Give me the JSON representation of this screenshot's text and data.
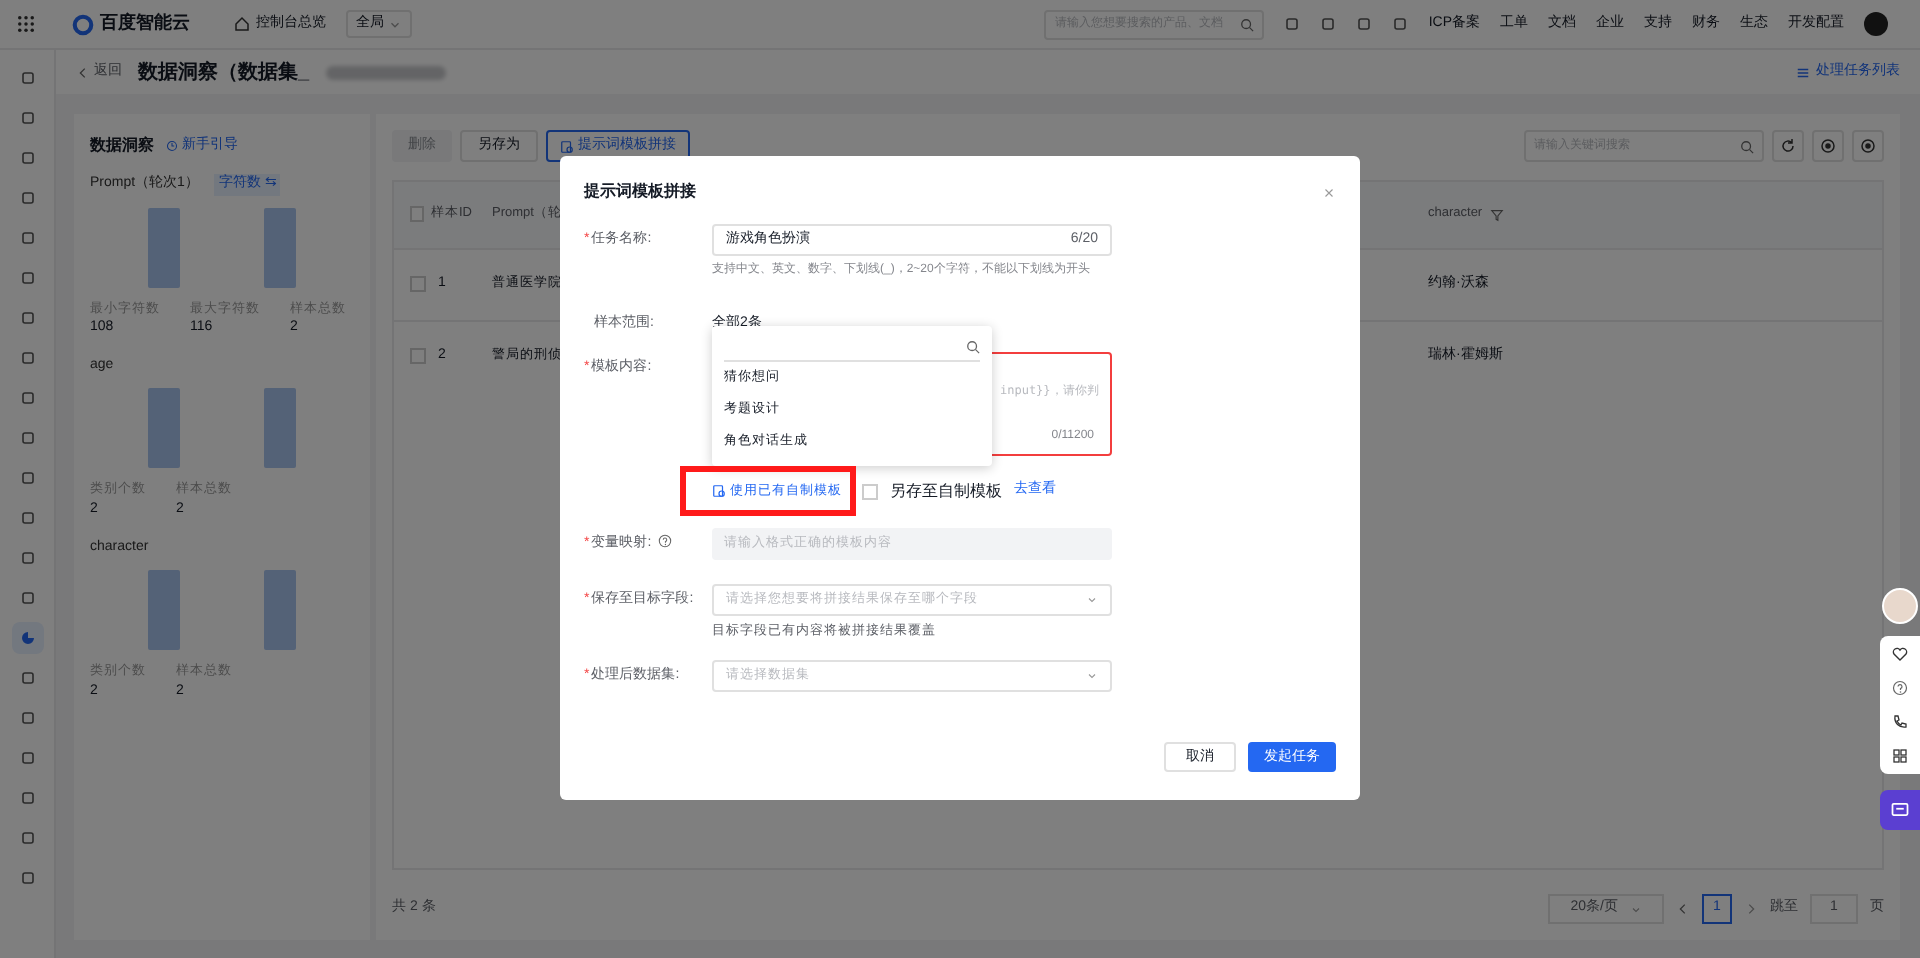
{
  "topbar": {
    "logo": "百度智能云",
    "console": "控制台总览",
    "region": "全局",
    "search_placeholder": "请输入您想要搜索的产品、文档",
    "links": [
      "ICP备案",
      "工单",
      "文档",
      "企业",
      "支持",
      "财务",
      "生态",
      "开发配置"
    ]
  },
  "header": {
    "back": "返回",
    "title": "数据洞察（数据集_",
    "task_list": "处理任务列表"
  },
  "rail": [
    {
      "selected": false
    },
    {
      "selected": false
    },
    {
      "selected": false
    },
    {
      "selected": false
    },
    {
      "selected": false
    },
    {
      "selected": false
    },
    {
      "selected": false
    },
    {
      "selected": false
    },
    {
      "selected": false
    },
    {
      "selected": false
    },
    {
      "selected": false
    },
    {
      "selected": false
    },
    {
      "selected": false
    },
    {
      "selected": false
    },
    {
      "selected": true
    },
    {
      "selected": false
    },
    {
      "selected": false
    },
    {
      "selected": false
    },
    {
      "selected": false
    },
    {
      "selected": false
    },
    {
      "selected": false
    }
  ],
  "insight": {
    "title": "数据洞察",
    "guide": "新手引导",
    "sections": [
      {
        "name": "Prompt（轮次1）",
        "tag": "字符数 ⇆",
        "stats": [
          {
            "label": "最小字符数",
            "value": "108"
          },
          {
            "label": "最大字符数",
            "value": "116"
          },
          {
            "label": "样本总数",
            "value": "2"
          }
        ]
      },
      {
        "name": "age",
        "stats": [
          {
            "label": "类别个数",
            "value": "2"
          },
          {
            "label": "样本总数",
            "value": "2"
          }
        ]
      },
      {
        "name": "character",
        "stats": [
          {
            "label": "类别个数",
            "value": "2"
          },
          {
            "label": "样本总数",
            "value": "2"
          }
        ]
      }
    ]
  },
  "toolbar": {
    "buttons": [
      {
        "label": "删除",
        "disabled": true,
        "primary": false
      },
      {
        "label": "另存为",
        "disabled": false,
        "primary": false
      },
      {
        "label": "提示词模板拼接",
        "disabled": false,
        "primary": true
      }
    ],
    "search_placeholder": "请输入关键词搜索"
  },
  "table": {
    "header_checked": false,
    "columns": [
      "样本ID",
      "Prompt（轮",
      "character"
    ],
    "rows": [
      {
        "id": "1",
        "checked": false,
        "prompt": "普通医学院",
        "character": "约翰·沃森"
      },
      {
        "id": "2",
        "checked": false,
        "prompt": "警局的刑侦",
        "character": "瑞林·霍姆斯"
      }
    ]
  },
  "footer": {
    "total": "共 2 条",
    "page_size": "20条/页",
    "page": "1",
    "jump_label": "跳至",
    "jump_value": "1",
    "page_unit": "页"
  },
  "dialog": {
    "title": "提示词模板拼接",
    "required_mark": "*",
    "name_label": "任务名称:",
    "name_value": "游戏角色扮演",
    "name_count": "6/20",
    "name_hint": "支持中文、英文、数字、下划线(_)，2~20个字符，不能以下划线为开头",
    "range_label": "样本范围:",
    "range_value": "全部2条",
    "template_label": "模板内容:",
    "template_placeholder": "input}}，请你判",
    "template_count": "0/11200",
    "template_error": true,
    "dropdown": {
      "items": [
        "猜你想问",
        "考题设计",
        "角色对话生成"
      ]
    },
    "use_template": "使用已有自制模板",
    "save_template": "另存至自制模板",
    "save_checked": false,
    "view_link": "去查看",
    "mapping_label": "变量映射:",
    "mapping_placeholder": "请输入格式正确的模板内容",
    "target_label": "保存至目标字段:",
    "target_placeholder": "请选择您想要将拼接结果保存至哪个字段",
    "target_hint": "目标字段已有内容将被拼接结果覆盖",
    "dataset_label": "处理后数据集:",
    "dataset_placeholder": "请选择数据集",
    "cancel": "取消",
    "submit": "发起任务"
  }
}
